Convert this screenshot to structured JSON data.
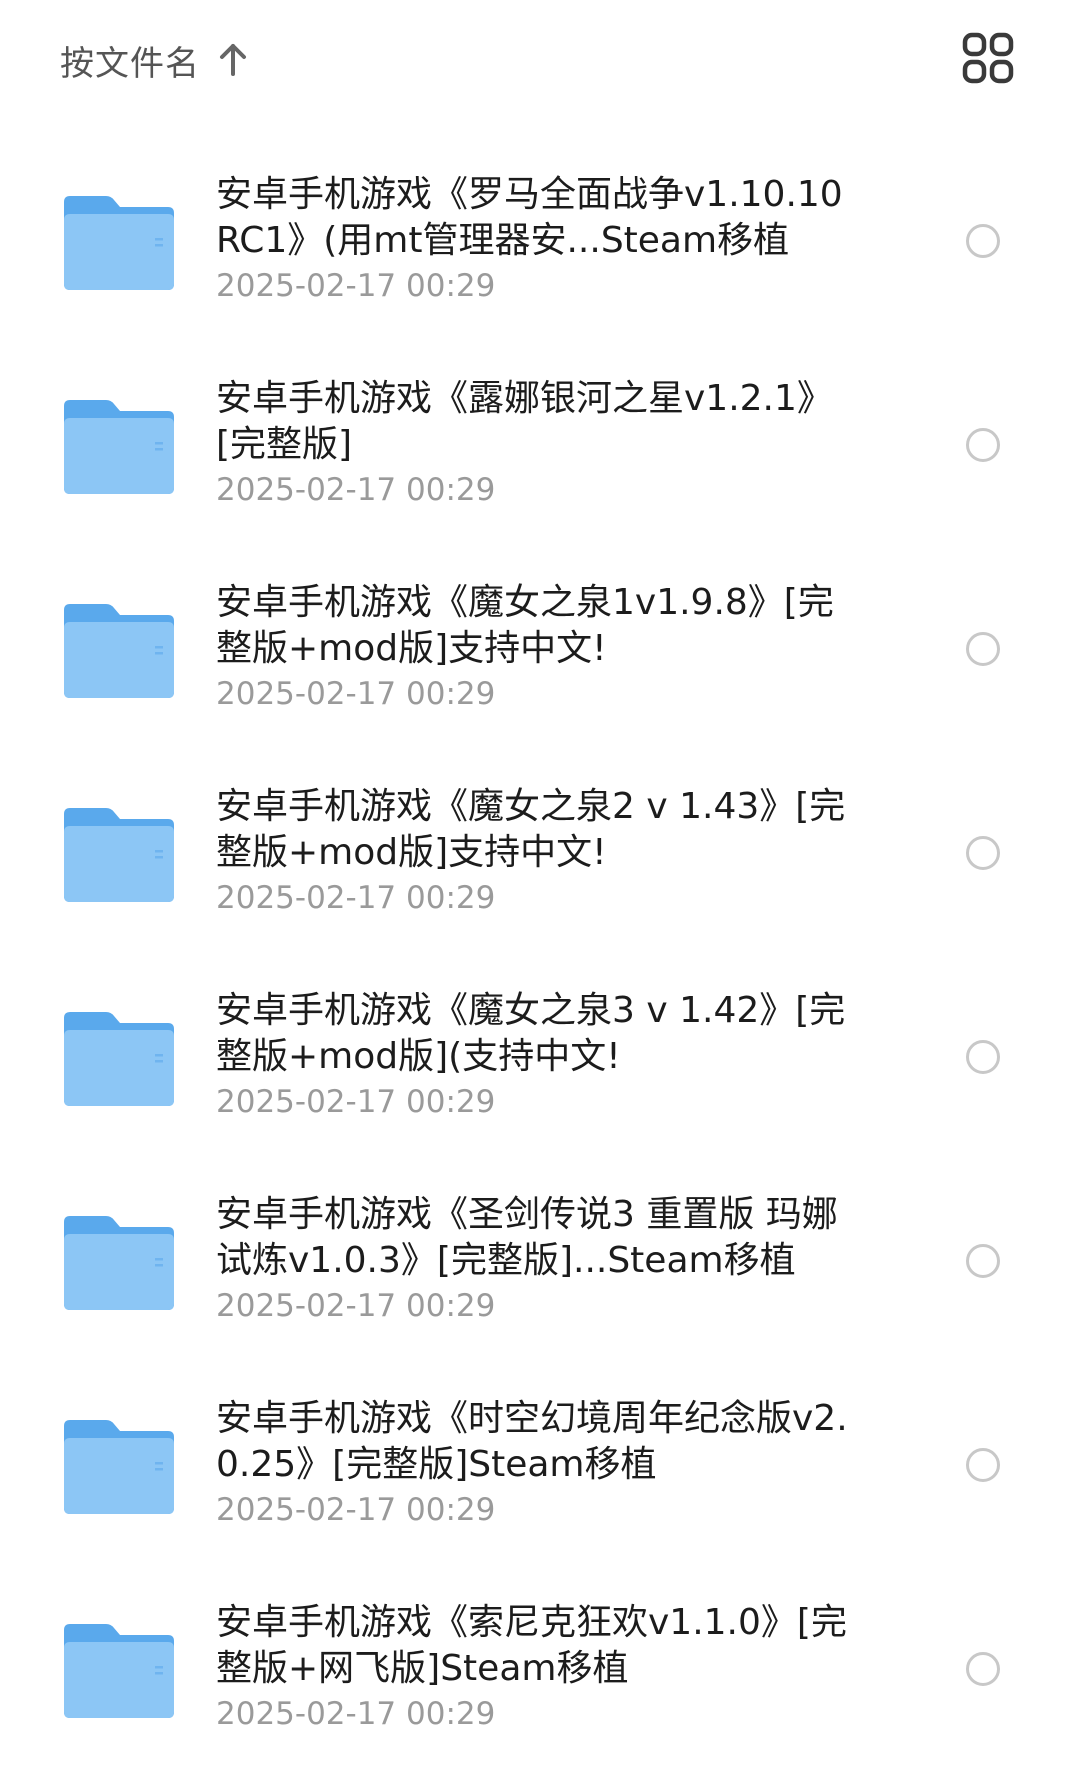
{
  "header": {
    "sort_label": "按文件名",
    "sort_icon": "arrow-up-icon",
    "view_toggle_icon": "grid-view-icon"
  },
  "colors": {
    "folder_light": "#8cc6f5",
    "folder_dark": "#5aa9ec",
    "radio_border": "#c8c8c8",
    "date_text": "#9a9a9a"
  },
  "files": [
    {
      "name": "安卓手机游戏《罗马全面战争v1.10.10RC1》(用mt管理器安...Steam移植",
      "date": "2025-02-17 00:29"
    },
    {
      "name": "安卓手机游戏《露娜银河之星v1.2.1》[完整版]",
      "date": "2025-02-17 00:29"
    },
    {
      "name": "安卓手机游戏《魔女之泉1v1.9.8》[完整版+mod版]支持中文!",
      "date": "2025-02-17 00:29"
    },
    {
      "name": "安卓手机游戏《魔女之泉2 v 1.43》[完整版+mod版]支持中文!",
      "date": "2025-02-17 00:29"
    },
    {
      "name": "安卓手机游戏《魔女之泉3 v 1.42》[完整版+mod版](支持中文!",
      "date": "2025-02-17 00:29"
    },
    {
      "name": "安卓手机游戏《圣剑传说3 重置版 玛娜试炼v1.0.3》[完整版]...Steam移植",
      "date": "2025-02-17 00:29"
    },
    {
      "name": "安卓手机游戏《时空幻境周年纪念版v2.0.25》[完整版]Steam移植",
      "date": "2025-02-17 00:29"
    },
    {
      "name": "安卓手机游戏《索尼克狂欢v1.1.0》[完整版+网飞版]Steam移植",
      "date": "2025-02-17 00:29"
    }
  ]
}
